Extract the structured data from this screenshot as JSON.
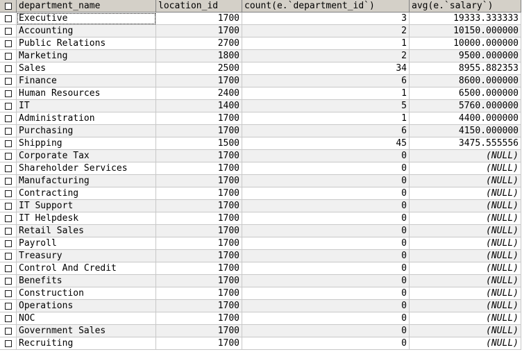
{
  "columns": [
    "department_name",
    "location_id",
    "count(e.`department_id`)",
    "avg(e.`salary`)"
  ],
  "rows": [
    {
      "department_name": "Executive",
      "location_id": "1700",
      "count": "3",
      "avg": "19333.333333"
    },
    {
      "department_name": "Accounting",
      "location_id": "1700",
      "count": "2",
      "avg": "10150.000000"
    },
    {
      "department_name": "Public Relations",
      "location_id": "2700",
      "count": "1",
      "avg": "10000.000000"
    },
    {
      "department_name": "Marketing",
      "location_id": "1800",
      "count": "2",
      "avg": "9500.000000"
    },
    {
      "department_name": "Sales",
      "location_id": "2500",
      "count": "34",
      "avg": "8955.882353"
    },
    {
      "department_name": "Finance",
      "location_id": "1700",
      "count": "6",
      "avg": "8600.000000"
    },
    {
      "department_name": "Human Resources",
      "location_id": "2400",
      "count": "1",
      "avg": "6500.000000"
    },
    {
      "department_name": "IT",
      "location_id": "1400",
      "count": "5",
      "avg": "5760.000000"
    },
    {
      "department_name": "Administration",
      "location_id": "1700",
      "count": "1",
      "avg": "4400.000000"
    },
    {
      "department_name": "Purchasing",
      "location_id": "1700",
      "count": "6",
      "avg": "4150.000000"
    },
    {
      "department_name": "Shipping",
      "location_id": "1500",
      "count": "45",
      "avg": "3475.555556"
    },
    {
      "department_name": "Corporate Tax",
      "location_id": "1700",
      "count": "0",
      "avg": "(NULL)"
    },
    {
      "department_name": "Shareholder Services",
      "location_id": "1700",
      "count": "0",
      "avg": "(NULL)"
    },
    {
      "department_name": "Manufacturing",
      "location_id": "1700",
      "count": "0",
      "avg": "(NULL)"
    },
    {
      "department_name": "Contracting",
      "location_id": "1700",
      "count": "0",
      "avg": "(NULL)"
    },
    {
      "department_name": "IT Support",
      "location_id": "1700",
      "count": "0",
      "avg": "(NULL)"
    },
    {
      "department_name": "IT Helpdesk",
      "location_id": "1700",
      "count": "0",
      "avg": "(NULL)"
    },
    {
      "department_name": "Retail Sales",
      "location_id": "1700",
      "count": "0",
      "avg": "(NULL)"
    },
    {
      "department_name": "Payroll",
      "location_id": "1700",
      "count": "0",
      "avg": "(NULL)"
    },
    {
      "department_name": "Treasury",
      "location_id": "1700",
      "count": "0",
      "avg": "(NULL)"
    },
    {
      "department_name": "Control And Credit",
      "location_id": "1700",
      "count": "0",
      "avg": "(NULL)"
    },
    {
      "department_name": "Benefits",
      "location_id": "1700",
      "count": "0",
      "avg": "(NULL)"
    },
    {
      "department_name": "Construction",
      "location_id": "1700",
      "count": "0",
      "avg": "(NULL)"
    },
    {
      "department_name": "Operations",
      "location_id": "1700",
      "count": "0",
      "avg": "(NULL)"
    },
    {
      "department_name": "NOC",
      "location_id": "1700",
      "count": "0",
      "avg": "(NULL)"
    },
    {
      "department_name": "Government Sales",
      "location_id": "1700",
      "count": "0",
      "avg": "(NULL)"
    },
    {
      "department_name": "Recruiting",
      "location_id": "1700",
      "count": "0",
      "avg": "(NULL)"
    }
  ],
  "selected_row": 0,
  "icons": {
    "row_checkbox": "checkbox-icon",
    "header_checkbox": "checkbox-icon"
  },
  "colors": {
    "header_bg": "#d4d0c8",
    "alt_row_bg": "#f0f0f0",
    "grid_line": "#c8c8c8"
  }
}
